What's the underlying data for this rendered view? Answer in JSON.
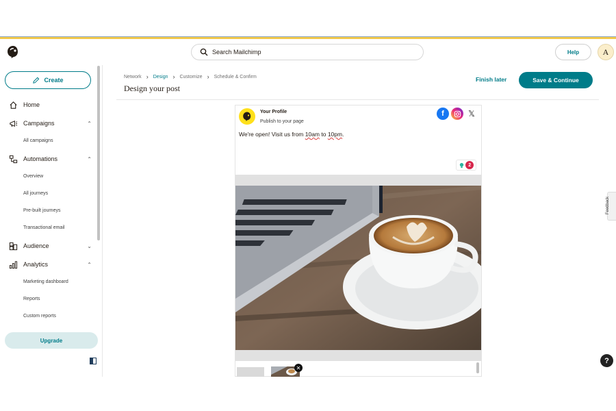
{
  "topbar": {
    "search_placeholder": "Search Mailchimp",
    "help_label": "Help",
    "avatar_initial": "A"
  },
  "sidebar": {
    "create_label": "Create",
    "items": [
      {
        "label": "Home"
      },
      {
        "label": "Campaigns",
        "expanded": true
      },
      {
        "label": "All campaigns"
      },
      {
        "label": "Automations",
        "expanded": true
      },
      {
        "label": "Overview"
      },
      {
        "label": "All journeys"
      },
      {
        "label": "Pre-built journeys"
      },
      {
        "label": "Transactional email"
      },
      {
        "label": "Audience",
        "expanded": false
      },
      {
        "label": "Analytics",
        "expanded": true
      },
      {
        "label": "Marketing dashboard"
      },
      {
        "label": "Reports"
      },
      {
        "label": "Custom reports"
      }
    ],
    "upgrade_label": "Upgrade"
  },
  "header": {
    "breadcrumbs": [
      "Network",
      "Design",
      "Customize",
      "Schedule & Confirm"
    ],
    "active_step": "Design",
    "title": "Design your post",
    "finish_later_label": "Finish later",
    "save_continue_label": "Save & Continue"
  },
  "post": {
    "profile_name": "Your Profile",
    "profile_sub": "Publish to your page",
    "text_before": "We're open! Visit us from ",
    "time_start": "10am",
    "text_mid": " to ",
    "time_end": "10pm",
    "text_after": ".",
    "platforms": [
      "facebook-icon",
      "instagram-icon",
      "x-icon"
    ],
    "issue_count": "2"
  },
  "feedback_label": "Feedback",
  "help_fab": "?",
  "colors": {
    "brand": "#007c89",
    "accent_yellow": "#ffe01b",
    "badge_red": "#d6264b"
  }
}
